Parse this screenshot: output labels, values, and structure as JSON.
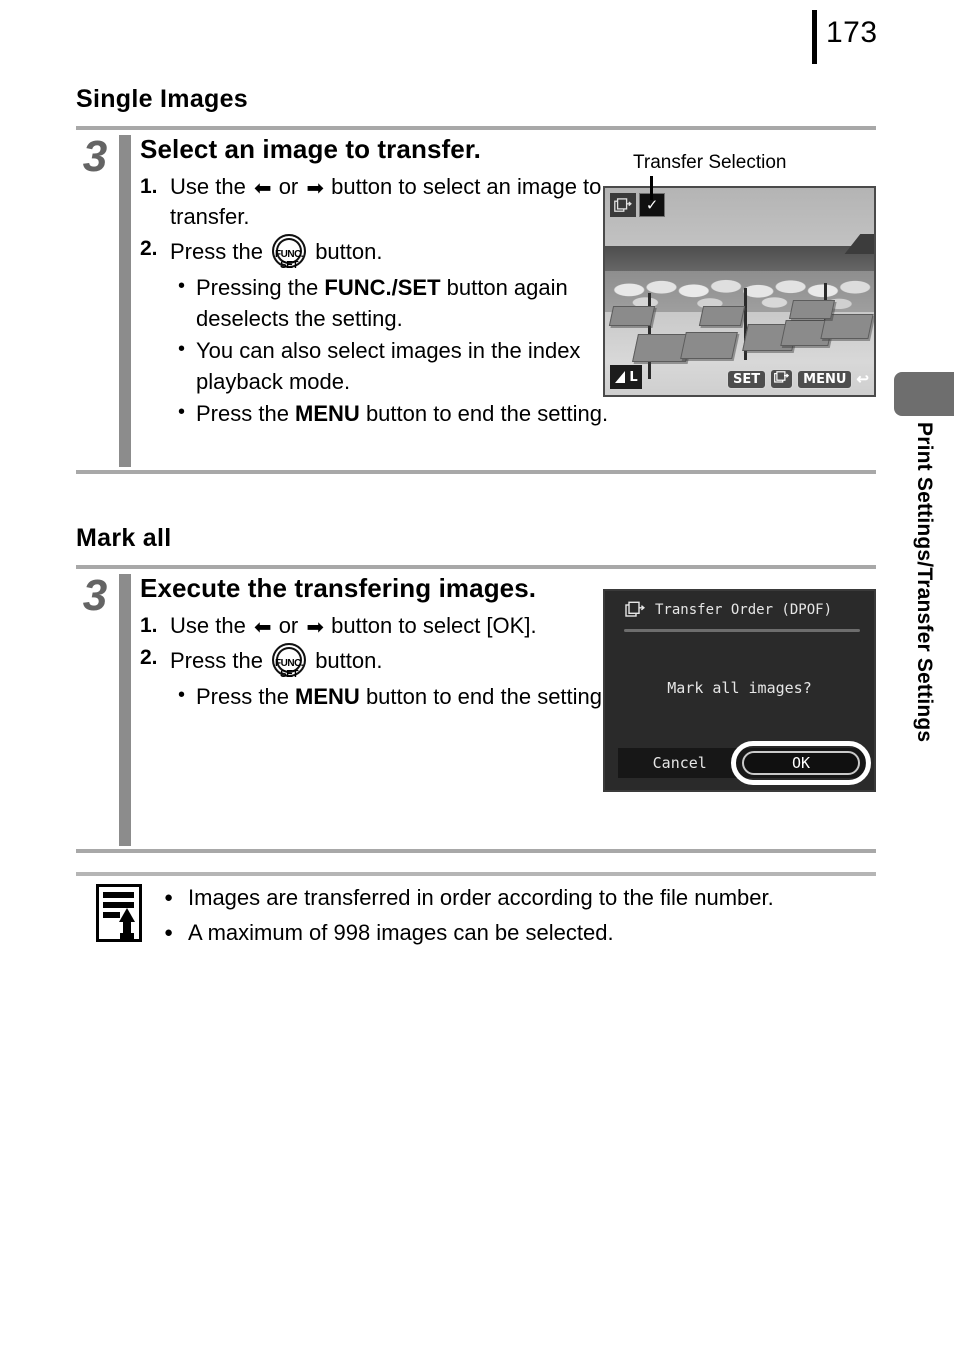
{
  "page": {
    "number": "173",
    "side_tab_label": "Print Settings/Transfer Settings",
    "side_tab_color": "#6e6e6e"
  },
  "sections": [
    {
      "heading": "Single Images",
      "step": {
        "number": "3",
        "title": "Select an image to transfer.",
        "substeps": [
          {
            "num": "1.",
            "pre": "Use the",
            "arrow_left": "⬅",
            "mid": "or",
            "arrow_right": "➡",
            "post": "button to select an image to transfer."
          },
          {
            "num": "2.",
            "pre": "Press the",
            "button_icon": "func-set",
            "post": "button."
          }
        ],
        "bullets": [
          {
            "before": "Pressing the ",
            "bold": "FUNC./SET",
            "after": " button again deselects the setting."
          },
          {
            "before": "You can also select images in the index playback mode.",
            "bold": "",
            "after": ""
          },
          {
            "before": "Press the ",
            "bold": "MENU",
            "after": " button to end the setting."
          }
        ]
      },
      "screen": {
        "callout_label": "Transfer Selection",
        "osd": {
          "transfer_icon": "transfer-order-icon",
          "check_mark": "✓",
          "quality_label": "L",
          "keys": [
            "SET",
            "transfer-icon",
            "MENU",
            "back-arrow-icon"
          ]
        }
      }
    },
    {
      "heading": "Mark all",
      "step": {
        "number": "3",
        "title": "Execute the transfering images.",
        "substeps": [
          {
            "num": "1.",
            "pre": "Use the",
            "arrow_left": "⬅",
            "mid": "or",
            "arrow_right": "➡",
            "post": "button to select [OK]."
          },
          {
            "num": "2.",
            "pre": "Press the",
            "button_icon": "func-set",
            "post": "button."
          }
        ],
        "bullets": [
          {
            "before": "Press the ",
            "bold": "MENU",
            "after": " button to end the setting."
          }
        ]
      },
      "screen": {
        "dialog_title": "Transfer Order (DPOF)",
        "message": "Mark all images?",
        "cancel_label": "Cancel",
        "ok_label": "OK",
        "selected_button": "OK"
      }
    }
  ],
  "note": {
    "icon": "note-pencil-icon",
    "items": [
      "Images are transferred in order according to the file number.",
      "A maximum of 998 images can be selected."
    ]
  },
  "func_set_button": {
    "line1": "FUNC.",
    "line2": "SET"
  }
}
